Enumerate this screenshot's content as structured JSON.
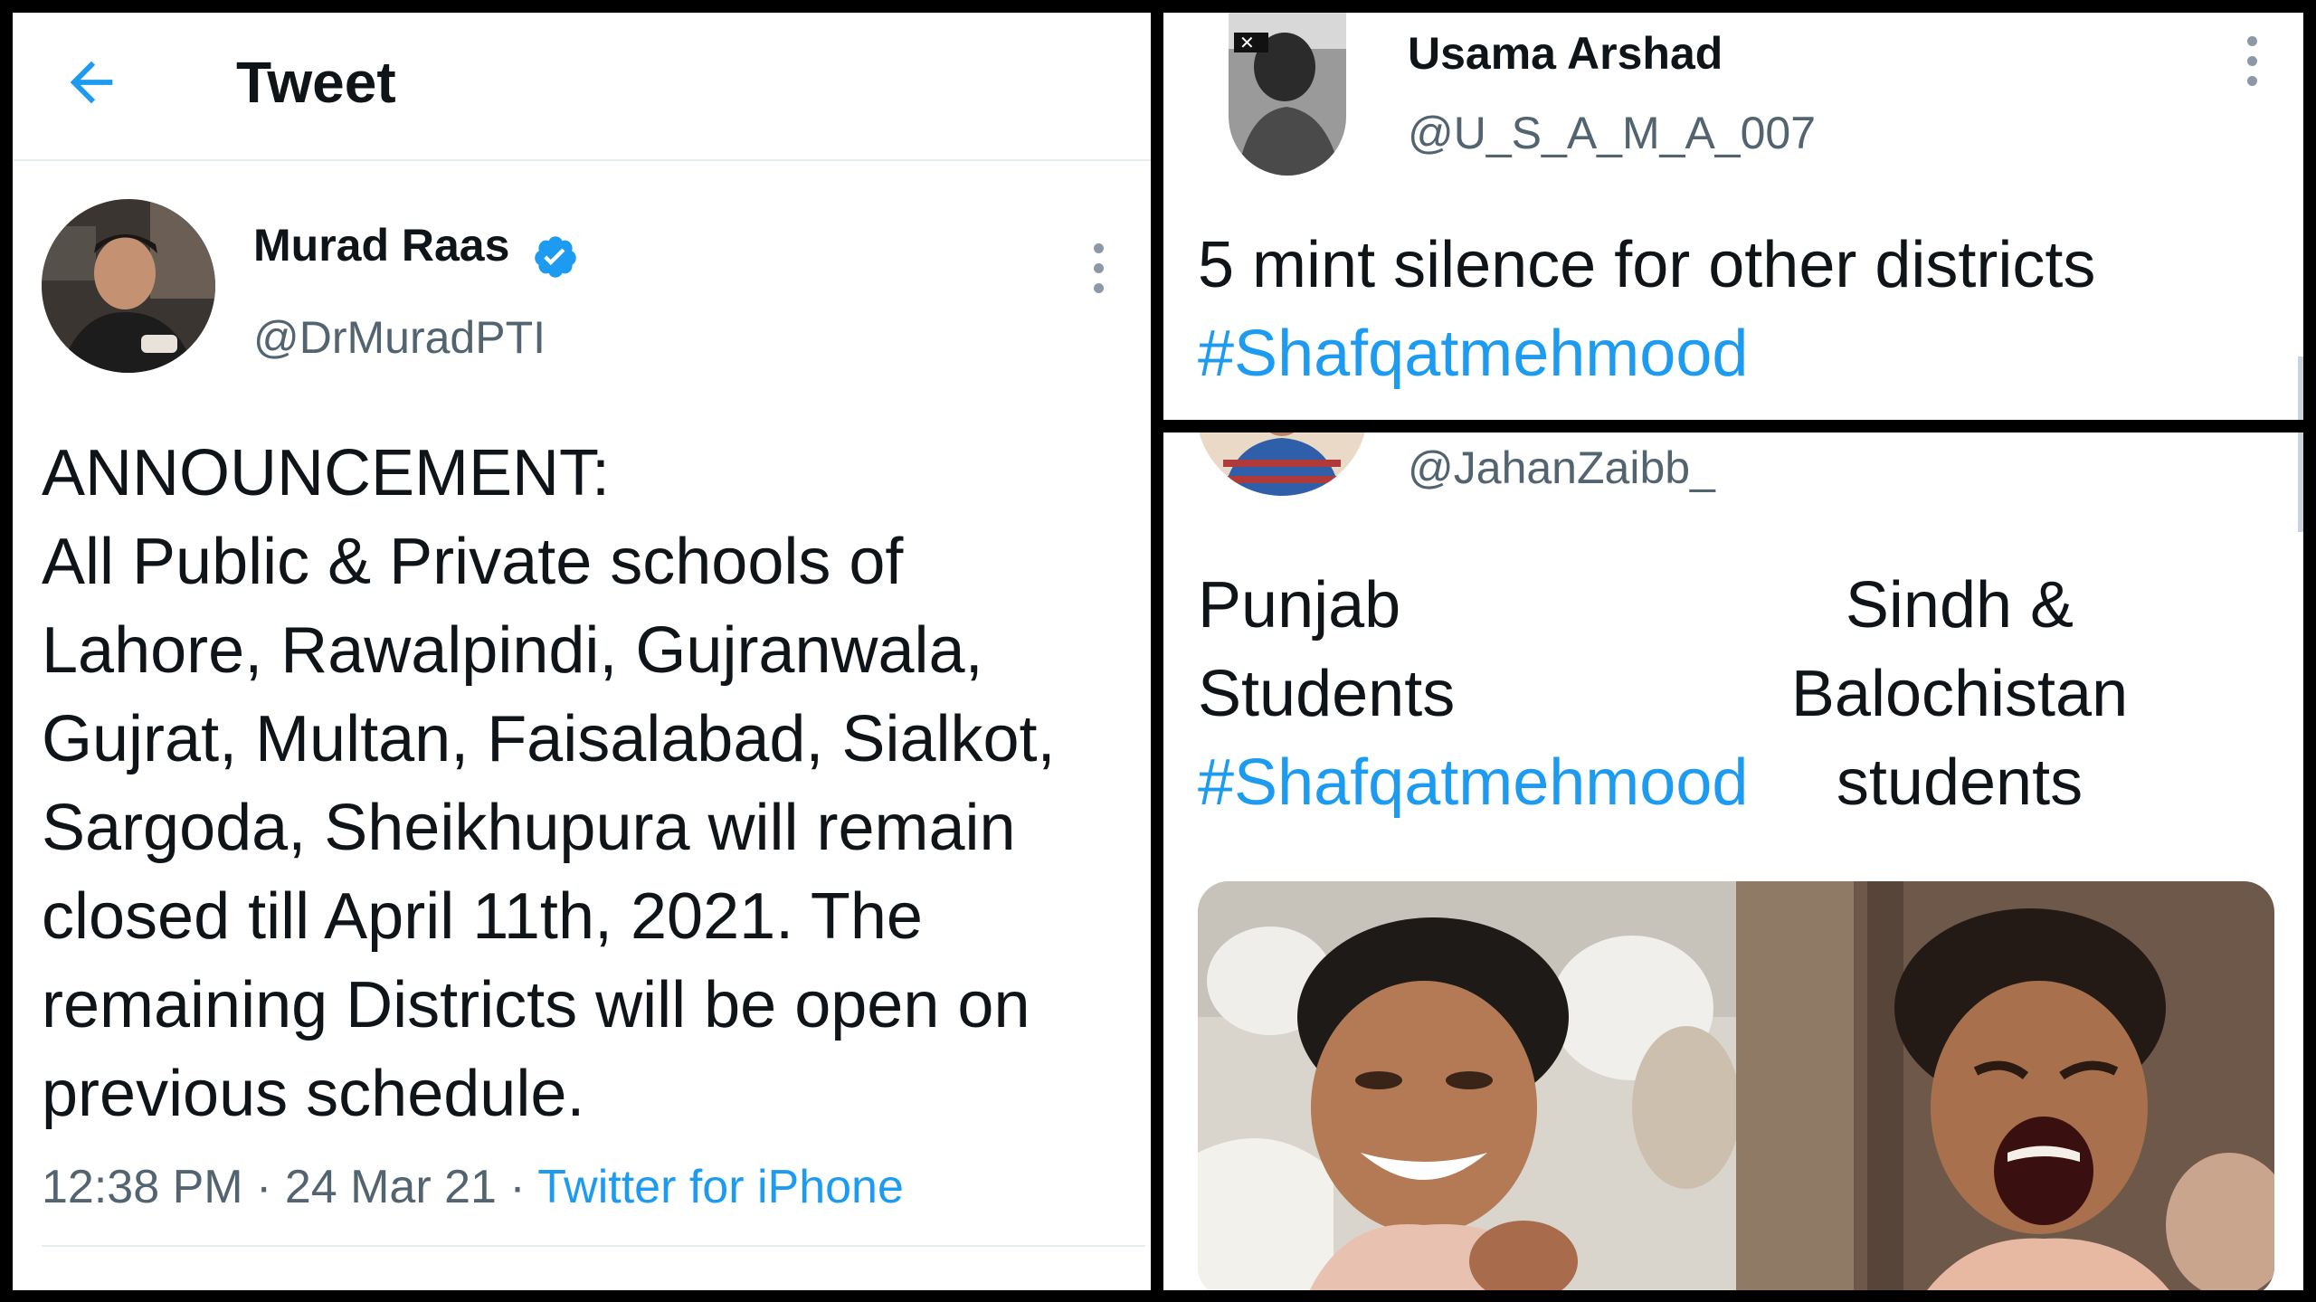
{
  "left_tweet": {
    "header_title": "Tweet",
    "author_name": "Murad Raas",
    "author_handle": "@DrMuradPTI",
    "verified": true,
    "body": "ANNOUNCEMENT:\nAll Public & Private schools of\nLahore, Rawalpindi, Gujranwala,\nGujrat, Multan, Faisalabad, Sialkot,\nSargoda, Sheikhupura will remain\nclosed till April 11th, 2021. The\nremaining Districts will be open on\nprevious schedule.",
    "time": "12:38 PM",
    "sep1": "·",
    "date": "24 Mar 21",
    "sep2": "·",
    "source": "Twitter for iPhone"
  },
  "top_right_tweet": {
    "author_name": "Usama Arshad",
    "author_handle": "@U_S_A_M_A_007",
    "body": "5 mint silence for other districts",
    "hashtag": "#Shafqatmehmood"
  },
  "bottom_right_tweet": {
    "author_handle": "@JahanZaibb_",
    "col_left": "Punjab\nStudents",
    "hashtag": "#Shafqatmehmood",
    "col_right": "Sindh &\nBalochistan\nstudents"
  },
  "colors": {
    "accent": "#1d9bf0",
    "secondary_text": "#536471",
    "text": "#0f1419",
    "divider": "#e6ecf0"
  },
  "icons": [
    "back-arrow-icon",
    "verified-badge-icon",
    "more-options-icon"
  ]
}
